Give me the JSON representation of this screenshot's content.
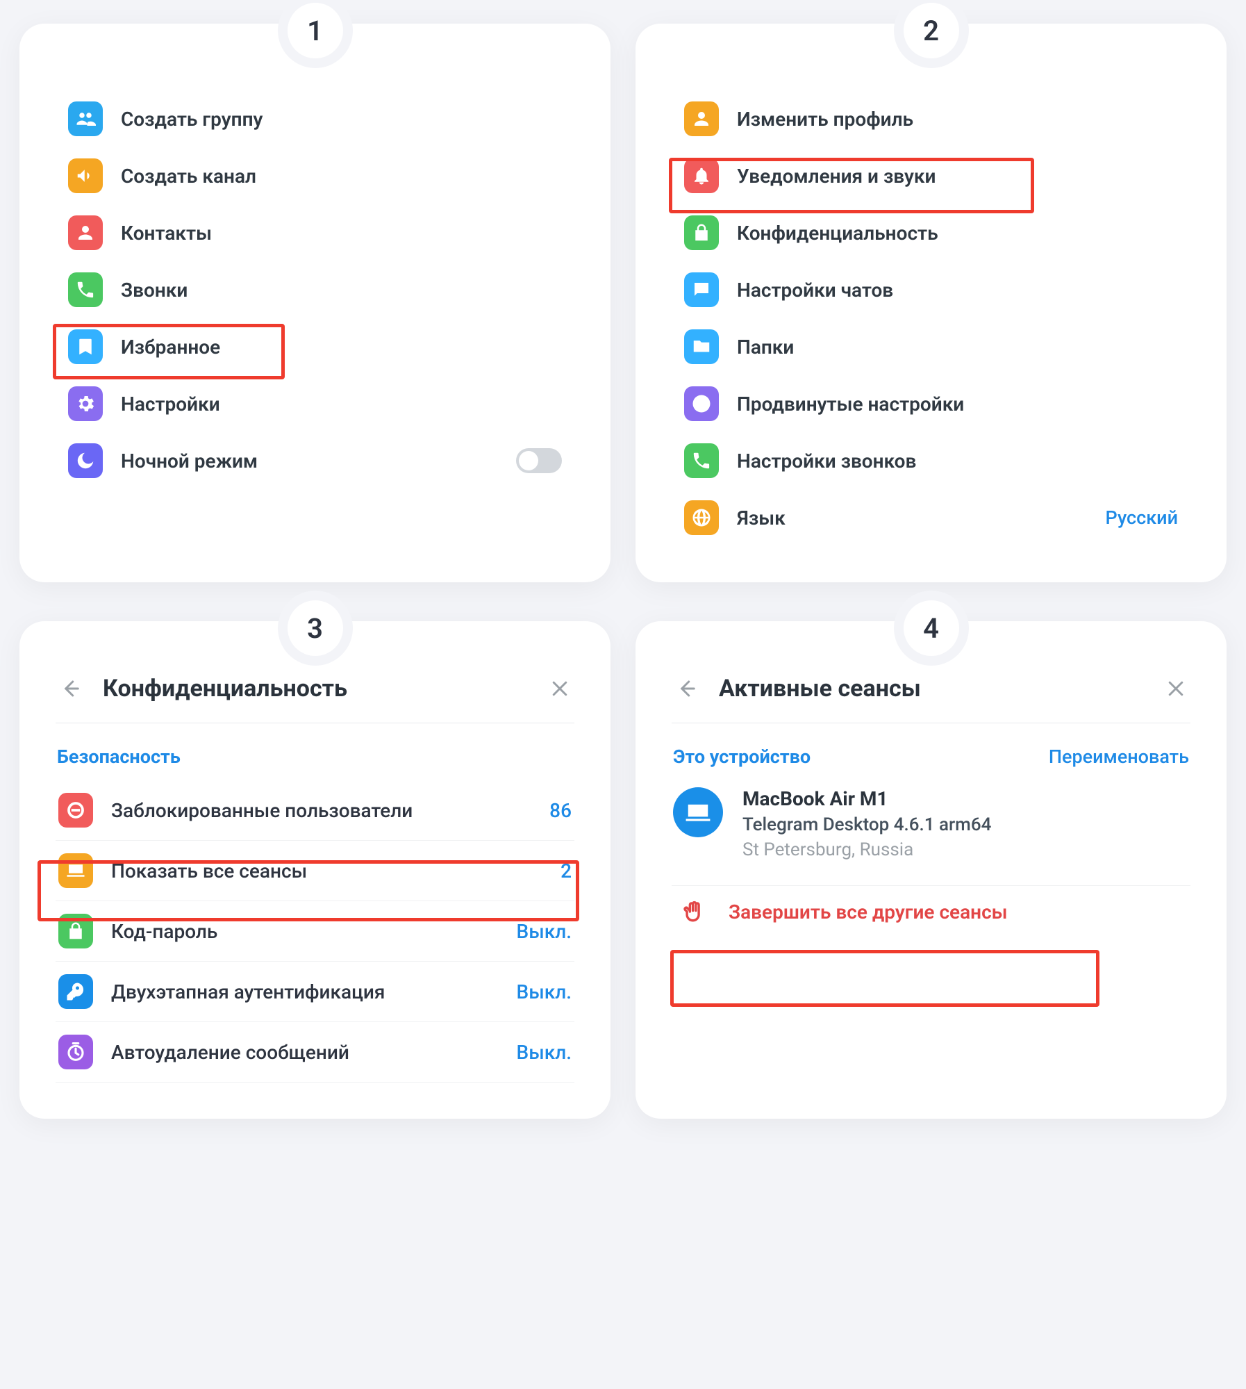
{
  "steps": {
    "s1": {
      "badge": "1"
    },
    "s2": {
      "badge": "2"
    },
    "s3": {
      "badge": "3"
    },
    "s4": {
      "badge": "4"
    }
  },
  "menu1": {
    "create_group": "Создать группу",
    "create_channel": "Создать канал",
    "contacts": "Контакты",
    "calls": "Звонки",
    "saved": "Избранное",
    "settings": "Настройки",
    "night_mode": "Ночной режим"
  },
  "menu2": {
    "edit_profile": "Изменить профиль",
    "notifications": "Уведомления и звуки",
    "privacy": "Конфиденциальность",
    "chat_settings": "Настройки чатов",
    "folders": "Папки",
    "advanced": "Продвинутые настройки",
    "call_settings": "Настройки звонков",
    "language_label": "Язык",
    "language_value": "Русский"
  },
  "panel3": {
    "title": "Конфиденциальность",
    "section": "Безопасность",
    "blocked_label": "Заблокированные пользователи",
    "blocked_value": "86",
    "sessions_label": "Показать все сеансы",
    "sessions_value": "2",
    "passcode_label": "Код-пароль",
    "passcode_value": "Выкл.",
    "twofa_label": "Двухэтапная аутентификация",
    "twofa_value": "Выкл.",
    "autodel_label": "Автоудаление сообщений",
    "autodel_value": "Выкл."
  },
  "panel4": {
    "title": "Активные сеансы",
    "section": "Это устройство",
    "rename": "Переименовать",
    "device_name": "MacBook Air M1",
    "device_app": "Telegram Desktop 4.6.1 arm64",
    "device_loc": "St Petersburg, Russia",
    "terminate": "Завершить все другие сеансы"
  }
}
